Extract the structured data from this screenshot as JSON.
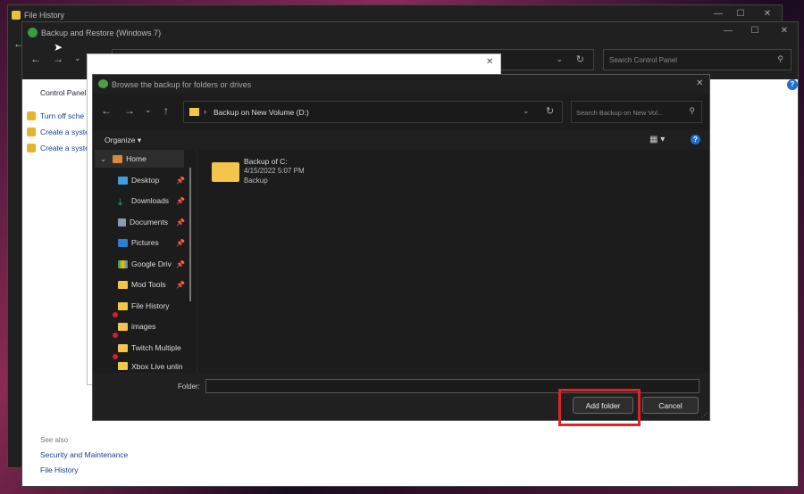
{
  "file_history_window": {
    "title": "File History"
  },
  "backup_window": {
    "title": "Backup and Restore (Windows 7)",
    "search_placeholder": "Search Control Panel",
    "sidebar": {
      "home": "Control Panel",
      "items": [
        "Turn off sche",
        "Create a syste",
        "Create a syste"
      ]
    },
    "see_also": {
      "heading": "See also",
      "links": [
        "Security and Maintenance",
        "File History"
      ]
    }
  },
  "dialog": {
    "title": "Browse the backup for folders or drives",
    "address": "Backup on New Volume (D:)",
    "search_placeholder": "Search Backup on New Vol...",
    "organize": "Organize",
    "tree": [
      {
        "label": "Home",
        "icon": "home-icon"
      },
      {
        "label": "Desktop",
        "icon": "desktop-icon",
        "pinned": true
      },
      {
        "label": "Downloads",
        "icon": "download-icon",
        "pinned": true
      },
      {
        "label": "Documents",
        "icon": "document-icon",
        "pinned": true
      },
      {
        "label": "Pictures",
        "icon": "pictures-icon",
        "pinned": true
      },
      {
        "label": "Google Driv",
        "icon": "google-drive-icon",
        "pinned": true
      },
      {
        "label": "Mod Tools",
        "icon": "folder-icon",
        "pinned": true
      },
      {
        "label": "File History",
        "icon": "folder-icon",
        "error": true
      },
      {
        "label": "images",
        "icon": "folder-icon",
        "error": true
      },
      {
        "label": "Twitch Multiple",
        "icon": "folder-icon",
        "error": true
      },
      {
        "label": "Xbox Live unlin",
        "icon": "folder-icon"
      }
    ],
    "files": [
      {
        "name": "Backup of C:",
        "date": "4/15/2022 5:07 PM",
        "type": "Backup"
      }
    ],
    "folder_label": "Folder:",
    "folder_value": "",
    "add_folder": "Add folder",
    "cancel": "Cancel",
    "highlight_color": "#d9252b"
  }
}
